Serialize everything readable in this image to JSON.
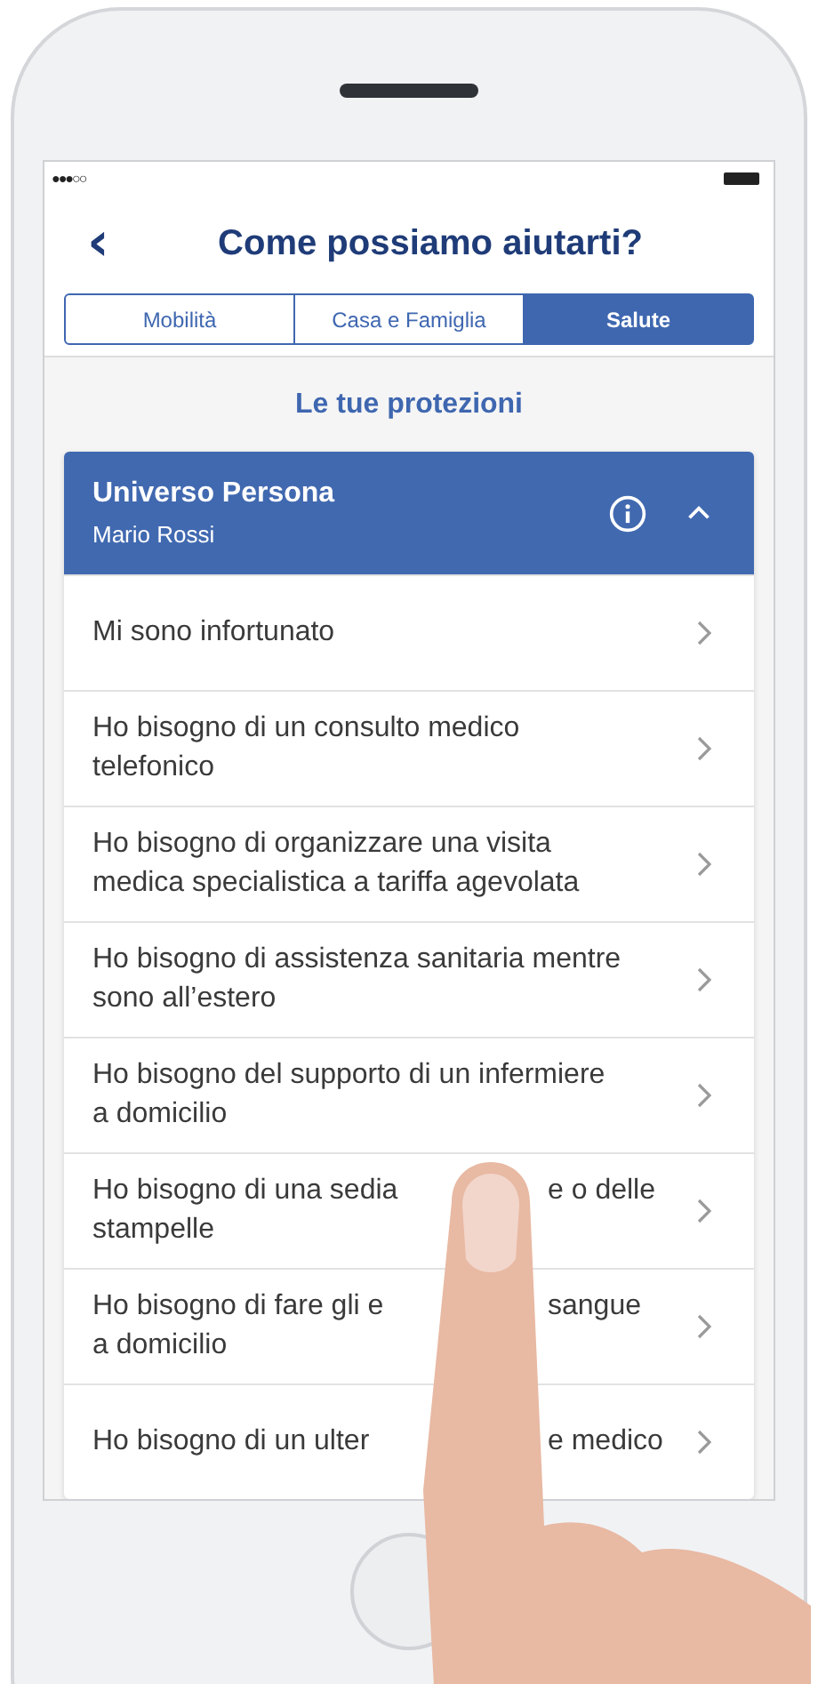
{
  "status_bar": {
    "signal_dots": "●●●○○"
  },
  "header": {
    "back": "‹",
    "title": "Come possiamo aiutarti?"
  },
  "tabs": [
    {
      "label": "Mobilità",
      "selected": false
    },
    {
      "label": "Casa e Famiglia",
      "selected": false
    },
    {
      "label": "Salute",
      "selected": true
    }
  ],
  "section_title": "Le tue protezioni",
  "card": {
    "title": "Universo Persona",
    "subtitle": "Mario Rossi",
    "expanded": true,
    "items": [
      {
        "lines": [
          [
            "Mi sono infortunato"
          ]
        ]
      },
      {
        "lines": [
          [
            "Ho bisogno di un consulto medico"
          ],
          [
            "telefonico"
          ]
        ]
      },
      {
        "lines": [
          [
            "Ho bisogno di organizzare una visita"
          ],
          [
            "medica specialistica a tariffa agevolata"
          ]
        ]
      },
      {
        "lines": [
          [
            "Ho bisogno di assistenza sanitaria mentre"
          ],
          [
            "sono all’estero"
          ]
        ]
      },
      {
        "lines": [
          [
            "Ho bisogno del supporto di un infermiere"
          ],
          [
            "a domicilio"
          ]
        ]
      },
      {
        "lines": [
          [
            "Ho bisogno di una sedia",
            "e o delle"
          ],
          [
            "stampelle"
          ]
        ]
      },
      {
        "lines": [
          [
            "Ho bisogno di fare gli e",
            "sangue"
          ],
          [
            "a domicilio"
          ]
        ]
      },
      {
        "lines": [
          [
            "Ho bisogno di un ulter",
            "e medico"
          ]
        ]
      }
    ]
  }
}
